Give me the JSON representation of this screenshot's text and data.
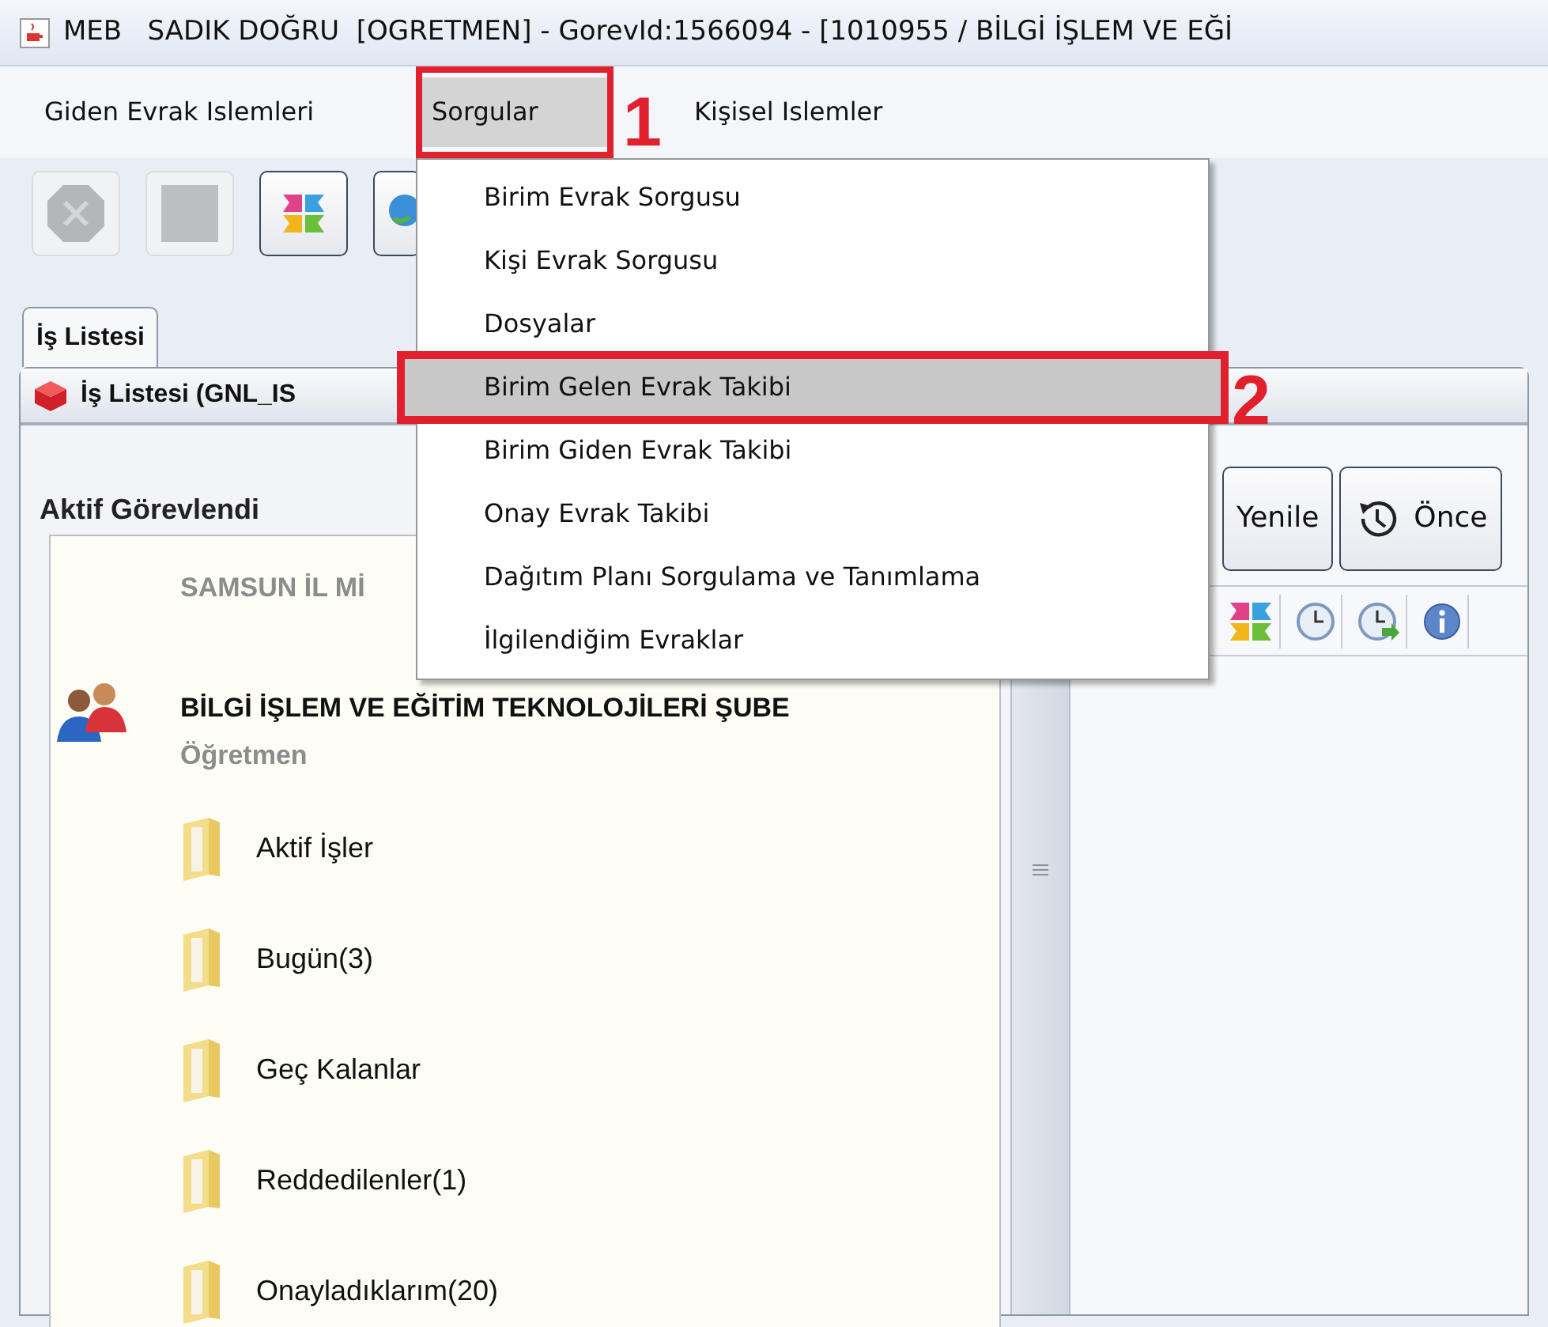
{
  "window": {
    "title": "MEB   SADIK DOĞRU  [OGRETMEN] - GorevId:1566094 - [1010955 / BİLGİ İŞLEM VE EĞİ"
  },
  "menu_bar": [
    {
      "label": "Giden Evrak Islemleri",
      "selected": false
    },
    {
      "label": "Sorgular",
      "selected": true
    },
    {
      "label": "Kişisel Islemler",
      "selected": false
    }
  ],
  "toolbar": [
    {
      "kind": "stop",
      "disabled": true
    },
    {
      "kind": "blank",
      "disabled": true
    },
    {
      "kind": "tiles",
      "disabled": false
    },
    {
      "kind": "globe",
      "disabled": false
    }
  ],
  "tabs": [
    {
      "label": "İş Listesi",
      "selected": true
    }
  ],
  "inner_window": {
    "title": "İş Listesi (GNL_IS"
  },
  "left_panel": {
    "title": "Aktif Görevlendi",
    "assignment": {
      "organization": "SAMSUN İL Mİ",
      "unit": "BİLGİ İŞLEM VE EĞİTİM TEKNOLOJİLERİ ŞUBE",
      "role": "Öğretmen"
    },
    "folders": [
      {
        "label": "Aktif İşler"
      },
      {
        "label": "Bugün(3)"
      },
      {
        "label": "Geç Kalanlar"
      },
      {
        "label": "Reddedilenler(1)"
      },
      {
        "label": "Onayladıklarım(20)"
      }
    ]
  },
  "right_pane": {
    "buttons": [
      {
        "label": "Yenile",
        "kind": "refresh"
      },
      {
        "label": "Önce",
        "kind": "history"
      }
    ],
    "toolbar": [
      {
        "kind": "tiles"
      },
      {
        "kind": "clock"
      },
      {
        "kind": "clock-forward"
      },
      {
        "kind": "info"
      }
    ]
  },
  "dropdown_menu": {
    "items": [
      {
        "label": "Birim Evrak Sorgusu",
        "selected": false
      },
      {
        "label": "Kişi Evrak Sorgusu",
        "selected": false
      },
      {
        "label": "Dosyalar",
        "selected": false
      },
      {
        "label": "Birim Gelen Evrak Takibi",
        "selected": true
      },
      {
        "label": "Birim Giden Evrak Takibi",
        "selected": false
      },
      {
        "label": "Onay Evrak Takibi",
        "selected": false
      },
      {
        "label": "Dağıtım Planı Sorgulama ve Tanımlama",
        "selected": false
      },
      {
        "label": "İlgilendiğim Evraklar",
        "selected": false
      }
    ]
  },
  "annotations": [
    {
      "label": "1"
    },
    {
      "label": "2"
    }
  ]
}
